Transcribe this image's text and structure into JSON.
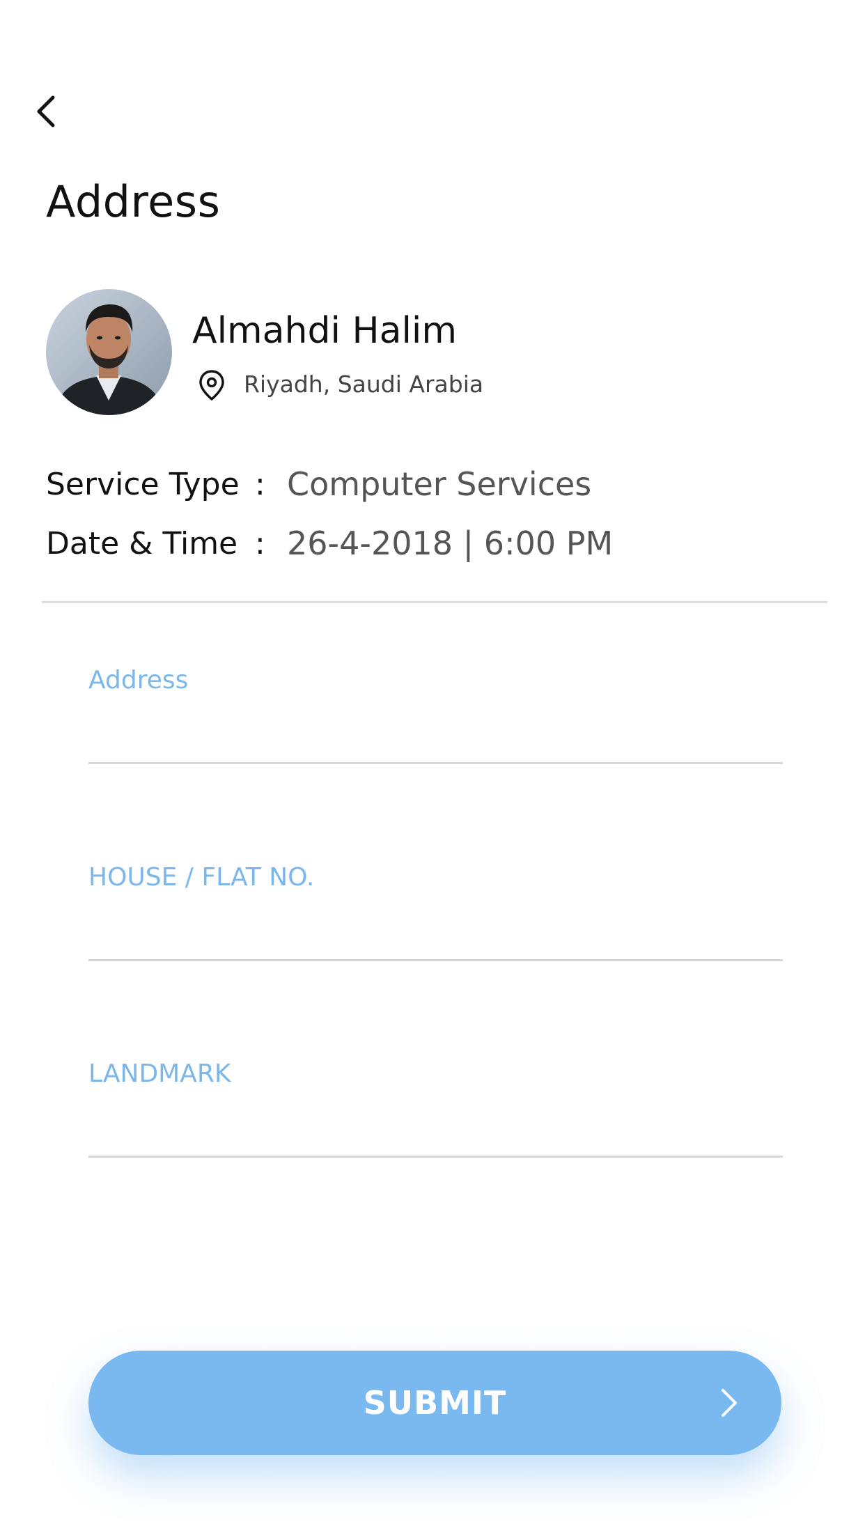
{
  "header": {
    "back_icon": "chevron-left-icon",
    "title": "Address"
  },
  "profile": {
    "name": "Almahdi Halim",
    "location_icon": "map-pin-icon",
    "location": "Riyadh, Saudi Arabia"
  },
  "details": [
    {
      "label": "Service Type",
      "separator": ":",
      "value": "Computer Services"
    },
    {
      "label": "Date & Time",
      "separator": ":",
      "value": "26-4-2018 | 6:00 PM"
    }
  ],
  "form": {
    "fields": [
      {
        "label": "Address",
        "value": ""
      },
      {
        "label": "HOUSE / FLAT NO.",
        "value": ""
      },
      {
        "label": "LANDMARK",
        "value": ""
      }
    ]
  },
  "submit": {
    "label": "SUBMIT",
    "icon": "chevron-right-icon"
  },
  "colors": {
    "accent": "#7ab9f0",
    "field_label": "#7bb7ea",
    "divider": "#dcdcdc"
  }
}
